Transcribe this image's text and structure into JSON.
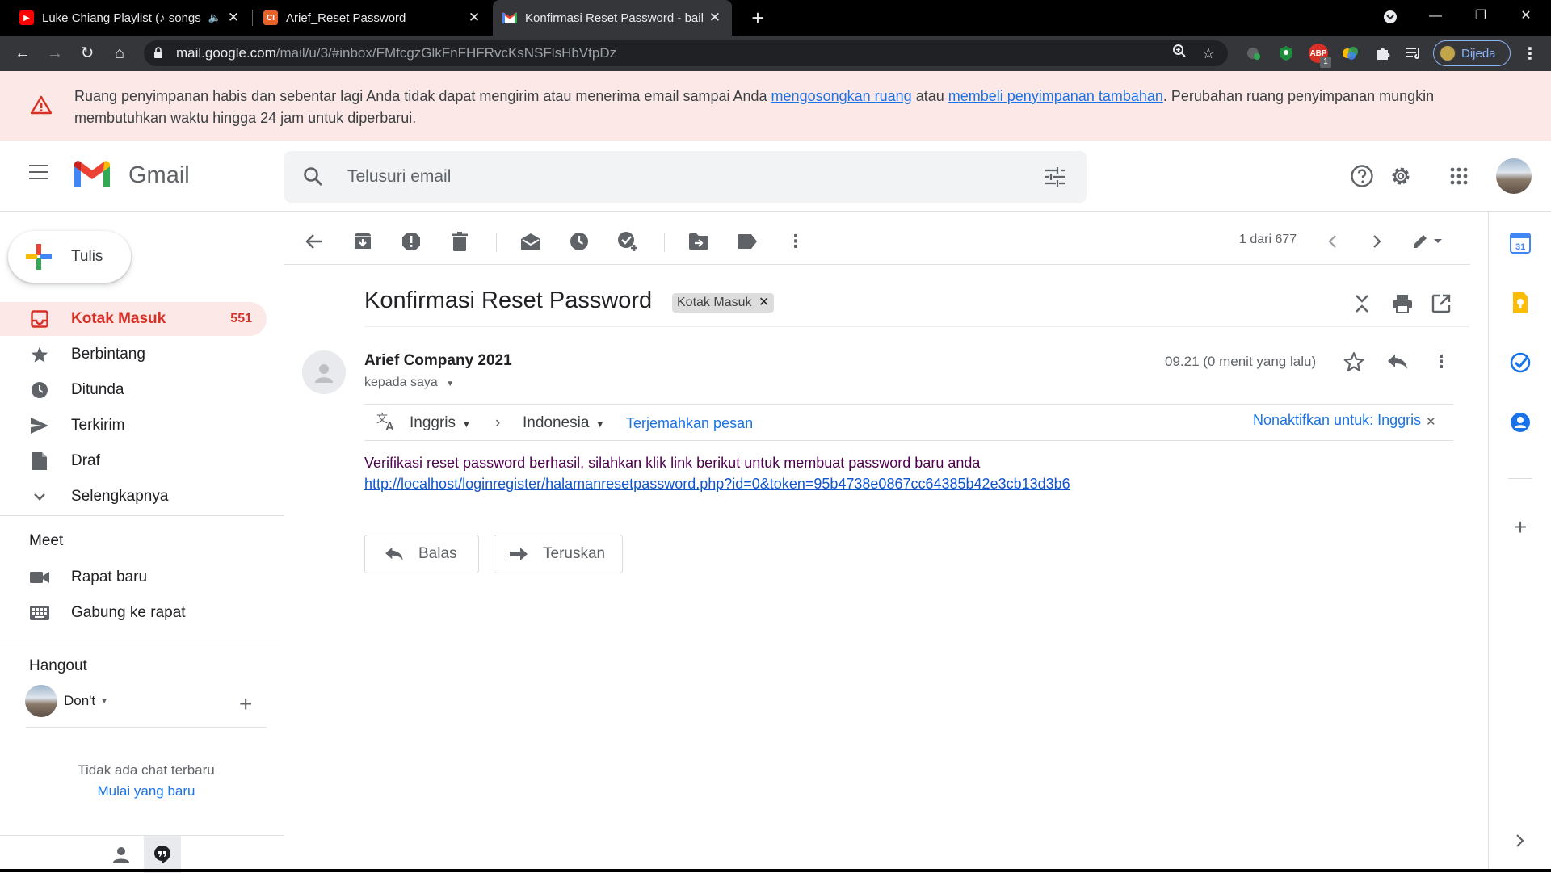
{
  "browser": {
    "tabs": [
      {
        "title": "Luke Chiang Playlist (♪ songs",
        "close": "✕"
      },
      {
        "title": "Arief_Reset Password",
        "close": "✕"
      },
      {
        "title": "Konfirmasi Reset Password - baih",
        "close": "✕"
      }
    ],
    "url_host": "mail.google.com",
    "url_path": "/mail/u/3/#inbox/FMfcgzGlkFnFHFRvcKsNSFlsHbVtpDz",
    "profile_label": "Dijeda",
    "ext_badge": "1",
    "ext_abp": "ABP"
  },
  "warning": {
    "text_before": "Ruang penyimpanan habis dan sebentar lagi Anda tidak dapat mengirim atau menerima email sampai Anda ",
    "link1": "mengosongkan ruang",
    "text_middle": " atau ",
    "link2": "membeli penyimpanan tambahan",
    "text_after": ". Perubahan ruang penyimpanan mungkin membutuhkan waktu hingga 24 jam untuk diperbarui."
  },
  "header": {
    "app_name": "Gmail",
    "search_placeholder": "Telusuri email"
  },
  "compose": {
    "label": "Tulis"
  },
  "nav": {
    "items": [
      {
        "label": "Kotak Masuk",
        "count": "551",
        "icon": "inbox-icon"
      },
      {
        "label": "Berbintang",
        "icon": "star-icon"
      },
      {
        "label": "Ditunda",
        "icon": "clock-icon"
      },
      {
        "label": "Terkirim",
        "icon": "send-icon"
      },
      {
        "label": "Draf",
        "icon": "draft-icon"
      },
      {
        "label": "Selengkapnya",
        "icon": "chevron-down-icon"
      }
    ],
    "meet_title": "Meet",
    "meet_items": [
      {
        "label": "Rapat baru",
        "icon": "video-icon"
      },
      {
        "label": "Gabung ke rapat",
        "icon": "keyboard-icon"
      }
    ],
    "hangout_title": "Hangout",
    "hangout_user": "Don't",
    "no_chat": "Tidak ada chat terbaru",
    "start_new": "Mulai yang baru"
  },
  "email": {
    "pager": "1 dari 677",
    "subject": "Konfirmasi Reset Password",
    "label_chip": "Kotak Masuk",
    "sender": "Arief Company 2021",
    "recipient": "kepada saya",
    "timestamp": "09.21 (0 menit yang lalu)",
    "translate": {
      "from_lang": "Inggris",
      "to_lang": "Indonesia",
      "translate_link": "Terjemahkan pesan",
      "disable_link": "Nonaktifkan untuk: Inggris"
    },
    "body_text": "Verifikasi reset password berhasil, silahkan klik link berikut untuk membuat password baru anda",
    "body_link": "http://localhost/loginregister/halamanresetpassword.php?id=0&token=95b4738e0867cc64385b42e3cb13d3b6",
    "reply_label": "Balas",
    "forward_label": "Teruskan"
  },
  "colors": {
    "accent_red": "#d93025",
    "link_blue": "#1a73e8",
    "warning_bg": "#fce8e6"
  }
}
